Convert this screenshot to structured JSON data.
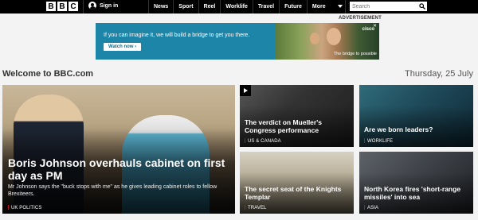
{
  "header": {
    "logo_letters": [
      "B",
      "B",
      "C"
    ],
    "signin_label": "Sign in",
    "nav": [
      "News",
      "Sport",
      "Reel",
      "Worklife",
      "Travel",
      "Future",
      "More"
    ],
    "search_placeholder": "Search"
  },
  "advert": {
    "label": "ADVERTISEMENT",
    "text": "If you can imagine it, we will build a bridge to get you there.",
    "button": "Watch now ›",
    "brand": "cisco",
    "tagline": "The bridge to possible"
  },
  "welcome": {
    "title": "Welcome to BBC.com",
    "date": "Thursday, 25 July"
  },
  "hero": {
    "title": "Boris Johnson overhauls cabinet on first day as PM",
    "summary": "Mr Johnson says the \"buck stops with me\" as he gives leading cabinet roles to fellow Brexiteers.",
    "tag": "UK POLITICS"
  },
  "cards": [
    {
      "title": "The verdict on Mueller's Congress performance",
      "tag": "US & CANADA"
    },
    {
      "title": "Are we born leaders?",
      "tag": "WORKLIFE"
    },
    {
      "title": "The secret seat of the Knights Templar",
      "tag": "TRAVEL"
    },
    {
      "title": "North Korea fires 'short-range missiles' into sea",
      "tag": "ASIA"
    }
  ]
}
